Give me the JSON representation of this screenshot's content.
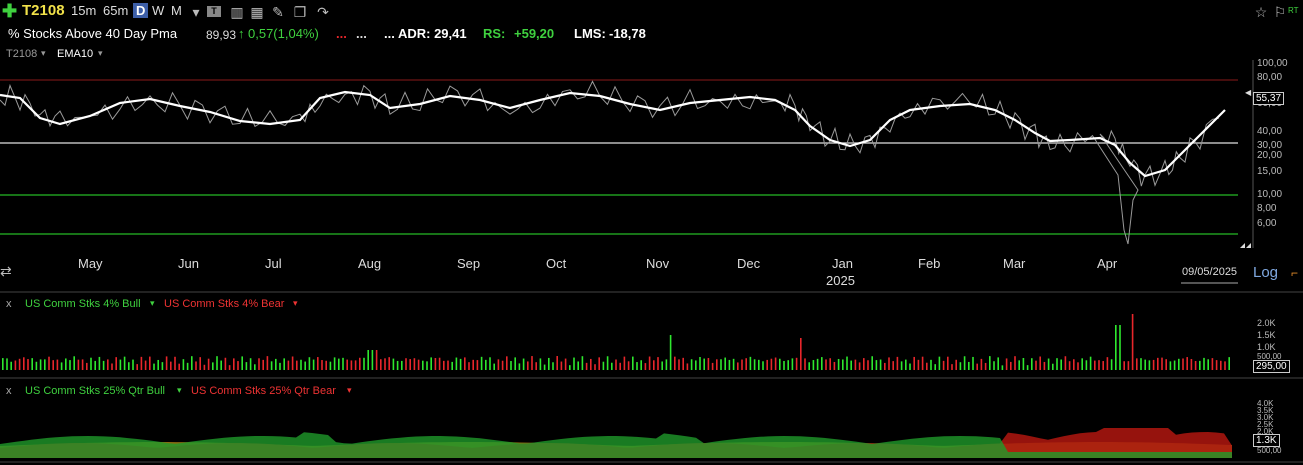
{
  "toolbar": {
    "symbol": "T2108",
    "periods": [
      "15m",
      "65m",
      "D",
      "W",
      "M"
    ],
    "active_period": "D",
    "icons": [
      "plus-icon",
      "dropdown-icon",
      "tile-icon",
      "bars-icon",
      "calc-icon",
      "pen-icon",
      "layers-icon",
      "share-icon",
      "star-icon",
      "flag-icon"
    ],
    "rt_label": "RT"
  },
  "info": {
    "title": "% Stocks Above 40 Day Pma",
    "last": "89,93",
    "change": "0,57(1,04%)",
    "dots1": "...",
    "dots2": "...",
    "adr_label": "... ADR: 29,41",
    "rs_label": "RS:",
    "rs_value": "+59,20",
    "lms_label": "LMS:",
    "lms_value": "-18,78"
  },
  "main_panel": {
    "symbol_tag": "T2108",
    "indicator_tag": "EMA10",
    "y_labels": [
      "100,00",
      "80,00",
      "60,00",
      "40,00",
      "30,00",
      "20,00",
      "15,00",
      "10,00",
      "8,00",
      "6,00"
    ],
    "current_value": "55,37",
    "months": [
      "May",
      "Jun",
      "Jul",
      "Aug",
      "Sep",
      "Oct",
      "Nov",
      "Dec",
      "Jan",
      "Feb",
      "Mar",
      "Apr"
    ],
    "year_label": "2025",
    "date_label": "09/05/2025",
    "log_label": "Log"
  },
  "panel2": {
    "close_x": "x",
    "bull_label": "US Comm Stks 4% Bull",
    "bear_label": "US Comm Stks 4% Bear",
    "y_labels": [
      "2.0K",
      "1.5K",
      "1.0K",
      "500,00"
    ],
    "current_value": "295,00"
  },
  "panel3": {
    "close_x": "x",
    "bull_label": "US Comm Stks 25% Qtr Bull",
    "bear_label": "US Comm Stks 25% Qtr Bear",
    "y_labels": [
      "4.0K",
      "3.5K",
      "3.0K",
      "2.5K",
      "2.0K",
      "500,00"
    ],
    "current_value": "1.3K"
  },
  "colors": {
    "bull": "#2ee82e",
    "bear": "#e8262b",
    "ema": "#ffffff",
    "price": "#9a9a9a",
    "accent": "#f2e24a",
    "area_bull": "#1f9a2a",
    "area_bear": "#b0160f",
    "area_base": "#8a6a10"
  }
}
